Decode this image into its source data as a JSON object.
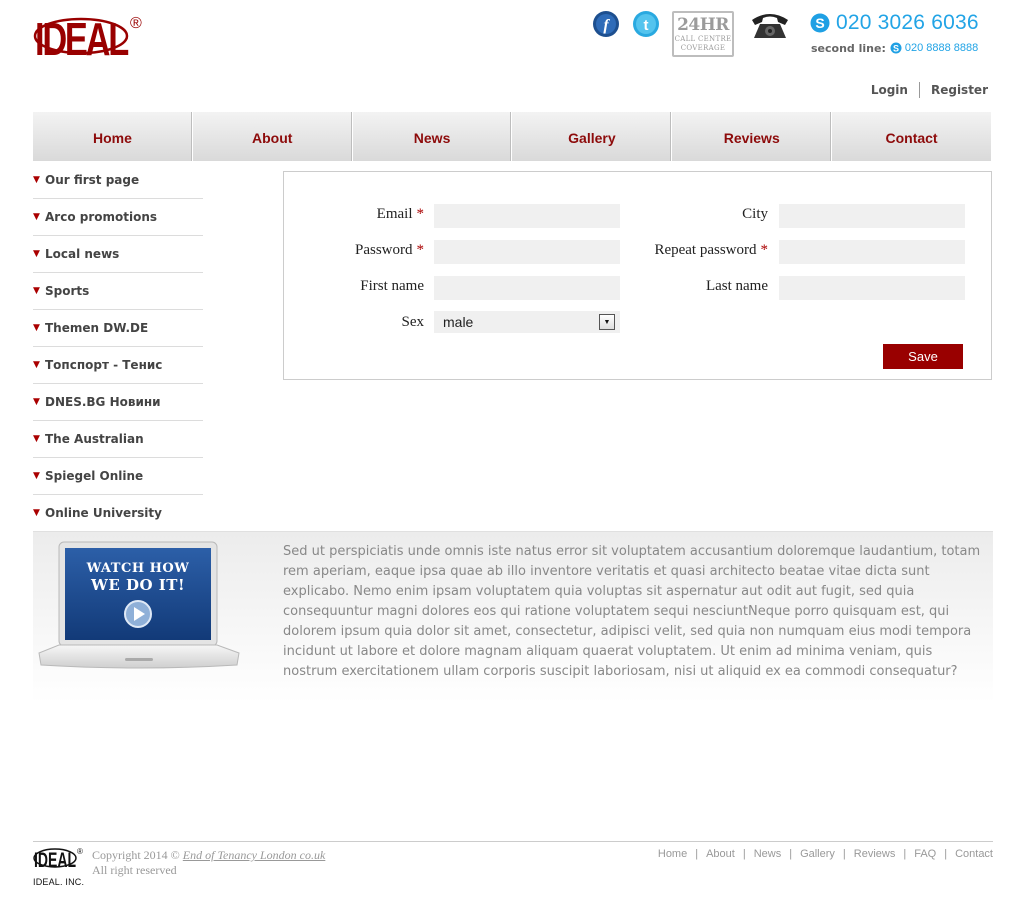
{
  "brand": {
    "logo_text": "IDEAL",
    "registered": "®",
    "accent_color": "#990000"
  },
  "header": {
    "social": [
      {
        "icon": "facebook-icon",
        "glyph": "f"
      },
      {
        "icon": "twitter-icon",
        "glyph": "t"
      }
    ],
    "badge": {
      "big": "24HR",
      "line1": "CALL CENTRE",
      "line2": "COVERAGE"
    },
    "phone_main": "020 3026 6036",
    "second_line_label": "second line:",
    "phone_second": "020 8888 8888"
  },
  "auth": {
    "login": "Login",
    "register": "Register"
  },
  "nav": [
    "Home",
    "About",
    "News",
    "Gallery",
    "Reviews",
    "Contact"
  ],
  "sidebar": [
    "Our first page",
    "Arco promotions",
    "Local news",
    "Sports",
    "Themen DW.DE",
    "Топспорт - Тенис",
    "DNES.BG Новини",
    "The Australian",
    "Spiegel Online",
    "Online University"
  ],
  "form": {
    "email_label": "Email",
    "password_label": "Password",
    "first_name_label": "First name",
    "sex_label": "Sex",
    "sex_value": "male",
    "city_label": "City",
    "repeat_password_label": "Repeat password",
    "last_name_label": "Last name",
    "required_mark": "*",
    "save_label": "Save"
  },
  "promo": {
    "video_line1": "WATCH HOW",
    "video_line2": "WE DO IT!",
    "text": "Sed ut perspiciatis unde omnis iste natus error sit voluptatem accusantium doloremque laudantium, totam rem aperiam, eaque ipsa quae ab illo inventore veritatis et quasi architecto beatae vitae dicta sunt explicabo. Nemo enim ipsam voluptatem quia voluptas sit aspernatur aut odit aut fugit, sed quia consequuntur magni dolores eos qui ratione voluptatem sequi nesciuntNeque porro quisquam est, qui dolorem ipsum quia dolor sit amet, consectetur, adipisci velit, sed quia non numquam eius modi tempora incidunt ut labore et dolore magnam aliquam quaerat voluptatem. Ut enim ad minima veniam, quis nostrum exercitationem ullam corporis suscipit laboriosam, nisi ut aliquid ex ea commodi consequatur?"
  },
  "footer": {
    "logo_text": "IDEAL",
    "logo_sub": "IDEAL. INC.",
    "copyright_prefix": "Copyright 2014 ©",
    "copyright_link": "End of Tenancy London co.uk",
    "rights": "All right reserved",
    "links": [
      "Home",
      "About",
      "News",
      "Gallery",
      "Reviews",
      "FAQ",
      "Contact"
    ]
  }
}
